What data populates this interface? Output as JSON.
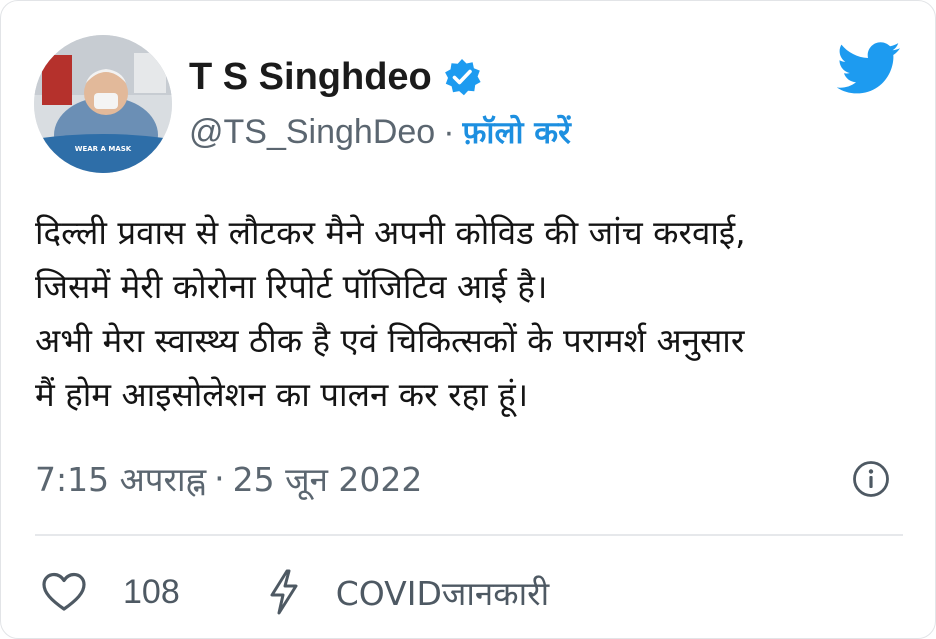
{
  "profile": {
    "display_name": "T S Singhdeo",
    "handle": "@TS_SinghDeo",
    "separator": "·",
    "follow_label": "फ़ॉलो करें",
    "avatar_badge_text": "WEAR A MASK"
  },
  "tweet": {
    "lines": [
      "दिल्ली प्रवास से लौटकर मैने अपनी कोविड की जांच करवाई,",
      "जिसमें मेरी कोरोना रिपोर्ट पॉजिटिव आई है।",
      "अभी मेरा स्वास्थ्य ठीक है एवं चिकित्सकों के परामर्श अनुसार",
      "मैं होम आइसोलेशन का पालन कर रहा हूं।"
    ],
    "time": "7:15 अपराह्न",
    "separator": "·",
    "date": "25 जून 2022"
  },
  "actions": {
    "like_count": "108",
    "covid_label": "COVIDजानकारी"
  },
  "icons": {
    "verified": "verified-badge-icon",
    "brand": "twitter-bird-icon",
    "info": "info-icon",
    "like": "heart-icon",
    "covid": "lightning-bolt-icon"
  },
  "colors": {
    "twitter_blue": "#1d9bf0",
    "follow_blue": "#1d8fe0",
    "text": "#141414",
    "muted": "#5b6670"
  }
}
